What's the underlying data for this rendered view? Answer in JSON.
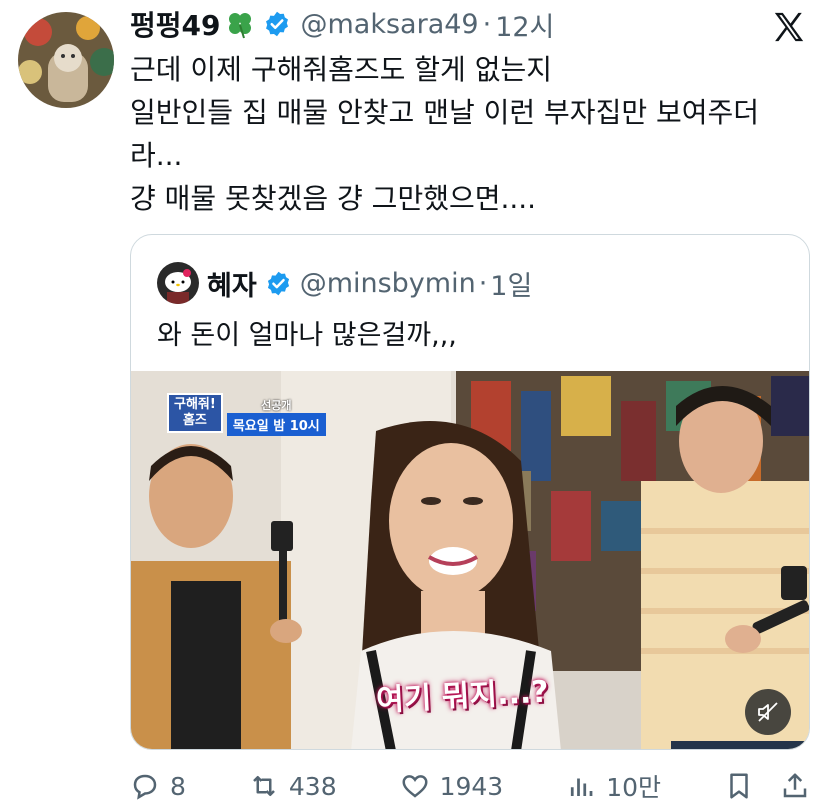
{
  "tweet": {
    "author_name": "펑펑49",
    "handle": "@maksara49",
    "separator": "·",
    "time": "12시",
    "lines": [
      "근데 이제 구해줘홈즈도 할게 없는지",
      "일반인들 집 매물 안찾고 맨날 이런 부자집만 보여주더",
      "라...",
      "걍 매물 못찾겠음 걍 그만했으면...."
    ]
  },
  "quote": {
    "author_name": "혜자",
    "handle": "@minsbymin",
    "separator": "·",
    "time": "1일",
    "text": "와 돈이 얼마나 많은걸까,,,",
    "video": {
      "logo_line1": "구해줘!",
      "logo_line2": "홈즈",
      "promo_top": "선공개",
      "promo_bottom": "목요일 밤 10시",
      "caption": "여기 뭐지...?"
    }
  },
  "actions": {
    "replies": "8",
    "retweets": "438",
    "likes": "1943",
    "views": "10만"
  },
  "icons": {
    "verified": "verified-badge-icon",
    "x_logo": "x-logo-icon",
    "reply": "reply-icon",
    "retweet": "retweet-icon",
    "like": "heart-icon",
    "views": "views-chart-icon",
    "bookmark": "bookmark-icon",
    "share": "share-icon",
    "mute": "mute-icon"
  },
  "colors": {
    "verified": "#1d9bf0",
    "secondary_text": "#536471",
    "border": "#cfd9de"
  }
}
